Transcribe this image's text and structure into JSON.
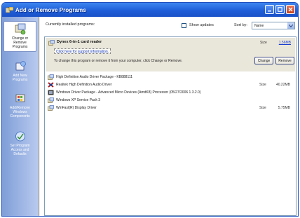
{
  "window": {
    "title": "Add or Remove Programs"
  },
  "sidebar": {
    "items": [
      {
        "label_lines": [
          "Change or",
          "Remove",
          "Programs"
        ],
        "icon": "change-remove-icon"
      },
      {
        "label_lines": [
          "Add New",
          "Programs"
        ],
        "icon": "add-new-icon"
      },
      {
        "label_lines": [
          "Add/Remove",
          "Windows",
          "Components"
        ],
        "icon": "windows-components-icon"
      },
      {
        "label_lines": [
          "Set Program",
          "Access and",
          "Defaults"
        ],
        "icon": "program-access-icon"
      }
    ]
  },
  "toolbar": {
    "installed_label": "Currently installed programs:",
    "show_updates_label": "Show updates",
    "show_updates_checked": false,
    "sort_label": "Sort by:",
    "sort_value": "Name"
  },
  "selected_program": {
    "name": "Dynex 6-in-1 card reader",
    "size_label": "Size",
    "size_value": "1.56MB",
    "support_link": "Click here for support information.",
    "change_text": "To change this program or remove it from your computer, click Change or Remove.",
    "change_button": "Change",
    "remove_button": "Remove"
  },
  "programs": [
    {
      "name": "High Definition Audio Driver Package - KB888111",
      "size_label": "",
      "size_value": "",
      "icon": "package-icon"
    },
    {
      "name": "Realtek High Definition Audio Driver",
      "size_label": "Size",
      "size_value": "40.22MB",
      "icon": "realtek-icon"
    },
    {
      "name": "Windows Driver Package - Advanced Micro Devices (AmdK8) Processor  (05/27/2006 1.3.2.0)",
      "size_label": "",
      "size_value": "",
      "icon": "driver-package-icon"
    },
    {
      "name": "Windows XP Service Pack 3",
      "size_label": "",
      "size_value": "",
      "icon": "package-icon"
    },
    {
      "name": "WinFast(R) Display Driver",
      "size_label": "Size",
      "size_value": "5.75MB",
      "icon": "package-icon"
    }
  ]
}
